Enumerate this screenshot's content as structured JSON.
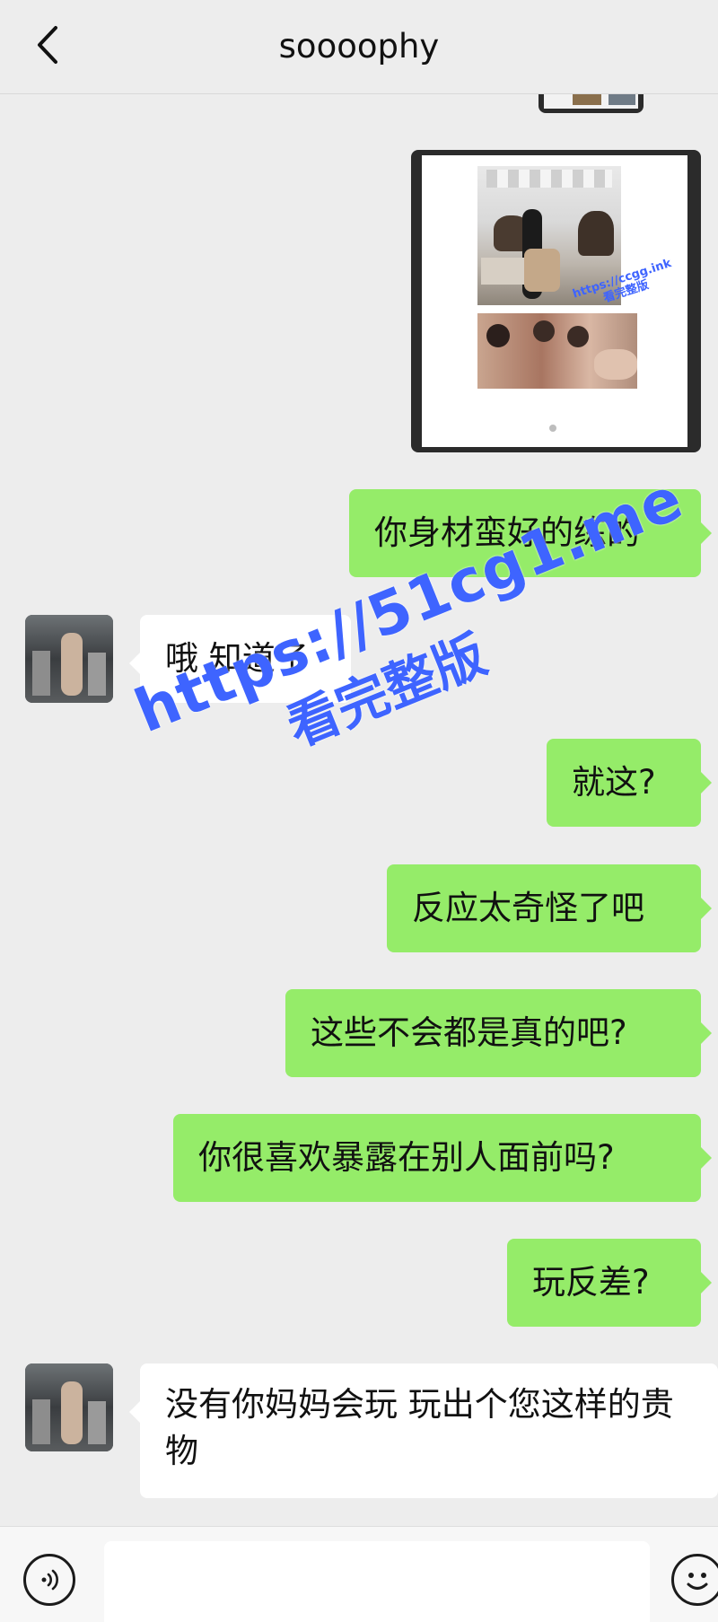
{
  "header": {
    "title": "soooophy",
    "back_icon": "chevron-left-icon"
  },
  "messages": [
    {
      "id": "m1",
      "from": "me",
      "type": "image"
    },
    {
      "id": "m2",
      "from": "me",
      "type": "text",
      "text": "你身材蛮好的练的"
    },
    {
      "id": "m3",
      "from": "them",
      "type": "text",
      "text": "哦 知道了"
    },
    {
      "id": "m4",
      "from": "me",
      "type": "text",
      "text": "就这?"
    },
    {
      "id": "m5",
      "from": "me",
      "type": "text",
      "text": "反应太奇怪了吧"
    },
    {
      "id": "m6",
      "from": "me",
      "type": "text",
      "text": "这些不会都是真的吧?"
    },
    {
      "id": "m7",
      "from": "me",
      "type": "text",
      "text": "你很喜欢暴露在别人面前吗?"
    },
    {
      "id": "m8",
      "from": "me",
      "type": "text",
      "text": "玩反差?"
    },
    {
      "id": "m9",
      "from": "them",
      "type": "text",
      "text": "没有你妈妈会玩 玩出个您这样的贵物"
    }
  ],
  "image_message": {
    "watermark_url": "https://ccgg.ink",
    "watermark_label": "看完整版"
  },
  "watermark": {
    "url": "https://51cg1.me",
    "label": "看完整版"
  },
  "input_bar": {
    "voice_icon": "voice-icon",
    "emoji_icon": "emoji-icon",
    "input_value": ""
  },
  "colors": {
    "sent_bubble": "#95ec69",
    "received_bubble": "#ffffff",
    "background": "#ededed",
    "watermark": "#3e64ff"
  }
}
